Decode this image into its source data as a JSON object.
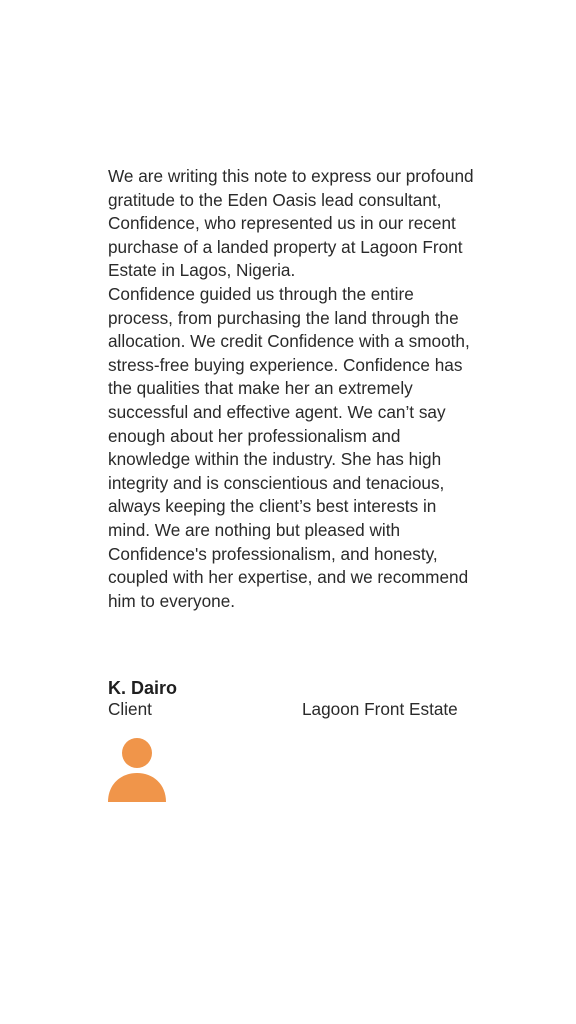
{
  "testimonial": {
    "paragraphs": [
      "We are writing this note to express our profound gratitude to the Eden Oasis lead consultant, Confidence, who represented us in our recent purchase of a landed property at Lagoon Front Estate in Lagos, Nigeria.",
      "Confidence guided us through the entire process, from purchasing the land through the allocation. We credit Confidence with a smooth, stress-free buying experience. Confidence has the qualities that make her an extremely successful and effective agent. We can’t say enough about her professionalism and knowledge within the industry. She has high integrity and is conscientious and tenacious, always keeping the client’s best interests in mind. We are nothing but pleased with Confidence's professionalism, and honesty, coupled with her expertise, and we recommend him to everyone."
    ]
  },
  "signature": {
    "name": "K. Dairo",
    "role": "Client",
    "estate": "Lagoon Front Estate"
  },
  "avatar": {
    "icon": "person-icon",
    "color": "#F0954A"
  }
}
